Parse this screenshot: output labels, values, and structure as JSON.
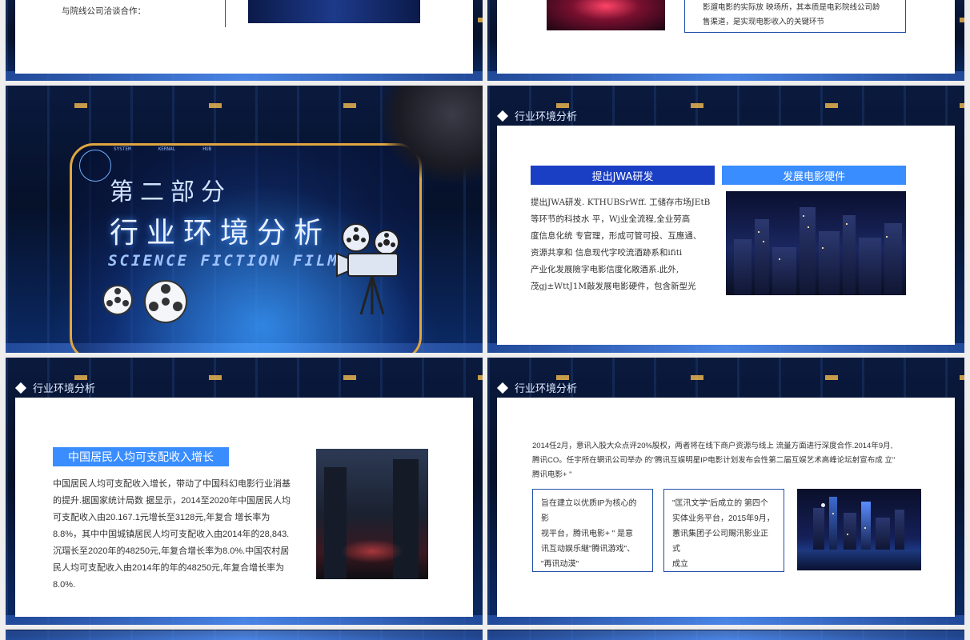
{
  "slide_top_left": {
    "text_line": "与院线公司洽谈合作："
  },
  "slide_top_right": {
    "text_lines": [
      "影遛电影的实际放 映场所，其本质是电彩院线公司龄",
      "售渠道，是实现电影收入的关键环节"
    ]
  },
  "section_slide": {
    "title_small": "第二部分",
    "title_big": "行业环境分析",
    "title_en": "SCIENCE FICTION FILM",
    "hud_labels": [
      "SYSTEM",
      "KERNAL",
      "HUB"
    ]
  },
  "slide_jwa": {
    "header": "行业环境分析",
    "bar_left": "提出JWA研发",
    "bar_right": "发展电影硬件",
    "paragraph_lines": [
      "提出JWA研发. KTHUBSrWff. 工储存市场JEtB",
      "等环节的科技水 平，Wj业全流程,全业劳高",
      "度信息化统 专官理，形成可管可投、互應通、",
      "资源共享和 信息现代字咬流酒跡系和ifiti",
      "产业化发展險字电影信度化敞酒系.此外,",
      "茂gj±WttJ1M敲发展电影硬件，包含新型光"
    ]
  },
  "slide_income": {
    "header": "行业环境分析",
    "bar": "中国居民人均可支配收入增长",
    "paragraph_lines": [
      "中国居民人均可支配收入增长，带动了中国科幻电影行业消基",
      "的提升.据国家统计局数 据显示，2014至2020年中国居民人均",
      "可支配收入由20.167.1元增长至3128元,年复合 增长率为",
      "8.8%，其中中国城镇居民人均可支配收入由2014年的28,843.",
      "沉瑁长至2020年的48250元,年复合增长率为8.0%.中国农村居",
      "民人均可支配收入由2014年的年的48250元,年复合增长率为",
      "8.0%."
    ]
  },
  "slide_tencent": {
    "header": "行业环境分析",
    "intro_lines": [
      "2014任2月，意讯入股大众点评20%股权，两者将在线下商户资源与线上 流量方面进行深度合作.2014年9月,",
      "腾讯CO。任宇所在辋讯公司举办 的\"腾讯互娱明星IP电影计划发布会性第二届互娱艺术高峰论坛射宣布成 立\"",
      "腾讯电影+ \""
    ],
    "box1_lines": [
      "旨在建立以优质IP为核心的影",
      "视平台，腾讯电影+ \" 是意",
      "讯互动娱乐継\"腾讯游戏\"、",
      "\"再讯动漠\""
    ],
    "box2_lines": [
      "\"匡汛文学\"后成立的 第四个",
      "实体业务平台，2015年9月，",
      "蕙讯集团子公司賜汛影业正式",
      "成立"
    ]
  },
  "colors": {
    "accent_dark": "#1a3fc4",
    "accent_light": "#3a8dff",
    "border": "#1f4fa8",
    "gold": "#e1a640"
  }
}
